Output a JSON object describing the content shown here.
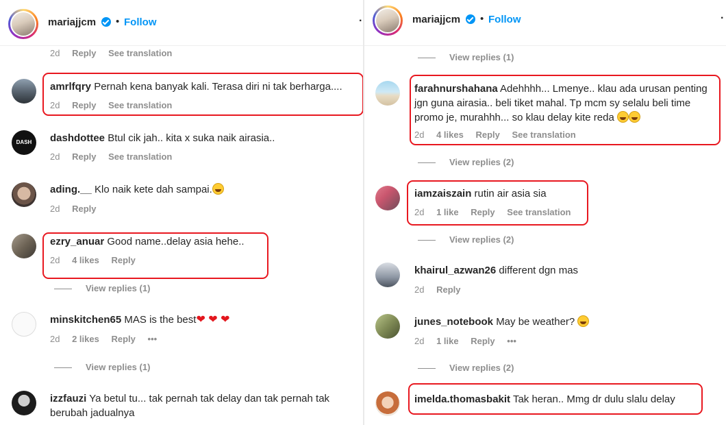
{
  "left": {
    "header": {
      "username": "mariajjcm",
      "dot": "•",
      "follow": "Follow",
      "more": "·"
    },
    "partial_meta": {
      "time": "2d",
      "reply": "Reply",
      "translate": "See translation"
    },
    "comments": [
      {
        "username": "amrlfqry",
        "text": "Pernah kena banyak kali. Terasa diri ni tak berharga....",
        "time": "2d",
        "reply": "Reply",
        "translate": "See translation"
      },
      {
        "username": "dashdottee",
        "text": "Btul cik jah.. kita x suka naik airasia..",
        "time": "2d",
        "reply": "Reply",
        "translate": "See translation",
        "avatar_text": "DASH"
      },
      {
        "username": "ading.__",
        "text": "Klo naik kete dah sampai.",
        "time": "2d",
        "reply": "Reply"
      },
      {
        "username": "ezry_anuar",
        "text": "Good name..delay asia hehe..",
        "time": "2d",
        "likes": "4 likes",
        "reply": "Reply",
        "view_replies": "View replies (1)"
      },
      {
        "username": "minskitchen65",
        "text": "MAS is the best",
        "time": "2d",
        "likes": "2 likes",
        "reply": "Reply",
        "more": "•••",
        "view_replies": "View replies (1)"
      },
      {
        "username": "izzfauzi",
        "text": "Ya betul tu... tak pernah tak delay dan tak pernah tak berubah jadualnya"
      }
    ]
  },
  "right": {
    "header": {
      "username": "mariajjcm",
      "dot": "•",
      "follow": "Follow",
      "more": "·"
    },
    "top_view_replies": "View replies (1)",
    "comments": [
      {
        "username": "farahnurshahana",
        "text": "Adehhhh... Lmenye.. klau ada urusan penting jgn guna airasia.. beli tiket mahal. Tp mcm sy selalu beli time promo je, murahhh... so klau delay kite reda",
        "time": "2d",
        "likes": "4 likes",
        "reply": "Reply",
        "translate": "See translation",
        "view_replies": "View replies (2)"
      },
      {
        "username": "iamzaiszain",
        "text": "rutin air asia sia",
        "time": "2d",
        "likes": "1 like",
        "reply": "Reply",
        "translate": "See translation",
        "view_replies": "View replies (2)"
      },
      {
        "username": "khairul_azwan26",
        "text": "different dgn mas",
        "time": "2d",
        "reply": "Reply"
      },
      {
        "username": "junes_notebook",
        "text": "May be weather?",
        "time": "2d",
        "likes": "1 like",
        "reply": "Reply",
        "more": "•••",
        "view_replies": "View replies (2)"
      },
      {
        "username": "imelda.thomasbakit",
        "text": "Tak heran.. Mmg dr dulu slalu delay"
      }
    ]
  },
  "colors": {
    "highlight": "#e8171f",
    "follow": "#0095f6",
    "muted": "#8e8e8e",
    "text": "#262626"
  }
}
